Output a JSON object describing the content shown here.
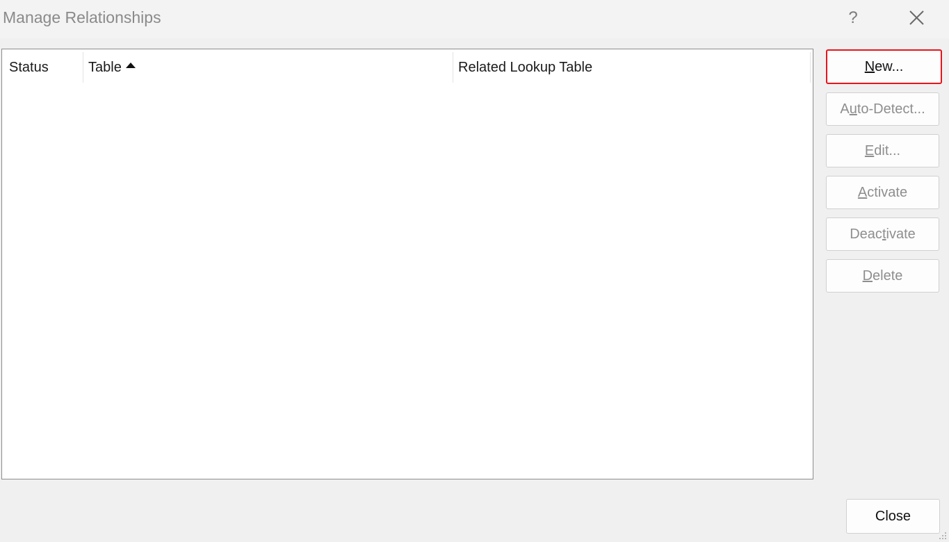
{
  "window": {
    "title": "Manage Relationships",
    "help_label": "?"
  },
  "list": {
    "columns": [
      "Status",
      "Table",
      "Related Lookup Table"
    ],
    "sort_column": "Table",
    "sort_direction": "ascending",
    "rows": []
  },
  "buttons": {
    "new": {
      "before": "",
      "mnemonic": "N",
      "after": "ew..."
    },
    "auto_detect": {
      "before": "A",
      "mnemonic": "u",
      "after": "to-Detect..."
    },
    "edit": {
      "before": "",
      "mnemonic": "E",
      "after": "dit..."
    },
    "activate": {
      "before": "",
      "mnemonic": "A",
      "after": "ctivate"
    },
    "deactivate": {
      "before": "Deac",
      "mnemonic": "t",
      "after": "ivate"
    },
    "delete": {
      "before": "",
      "mnemonic": "D",
      "after": "elete"
    },
    "close": "Close"
  },
  "colors": {
    "highlight_border": "#e8141c",
    "disabled_text": "#8e8e8e",
    "dialog_background": "#f0f0f0"
  }
}
